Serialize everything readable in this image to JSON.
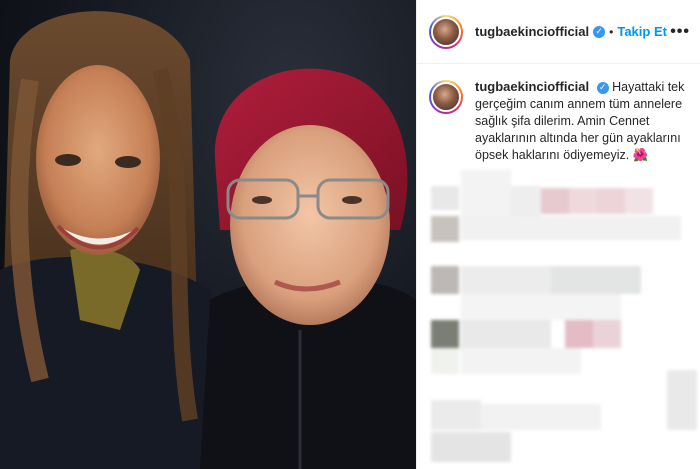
{
  "post": {
    "username": "tugbaekinciofficial",
    "follow_label": "Takip Et",
    "separator": "•",
    "more_label": "•••",
    "verified_glyph": "✓",
    "caption": "Hayattaki tek gerçeğim canım annem tüm annelere sağlık şifa dilerim. Amin Cennet ayaklarının altında her gün ayaklarını öpsek haklarını ödiyemeyiz.",
    "caption_emoji": "🌺"
  },
  "colors": {
    "link_blue": "#0095f6",
    "verified_blue": "#3897f0",
    "text": "#262626"
  }
}
